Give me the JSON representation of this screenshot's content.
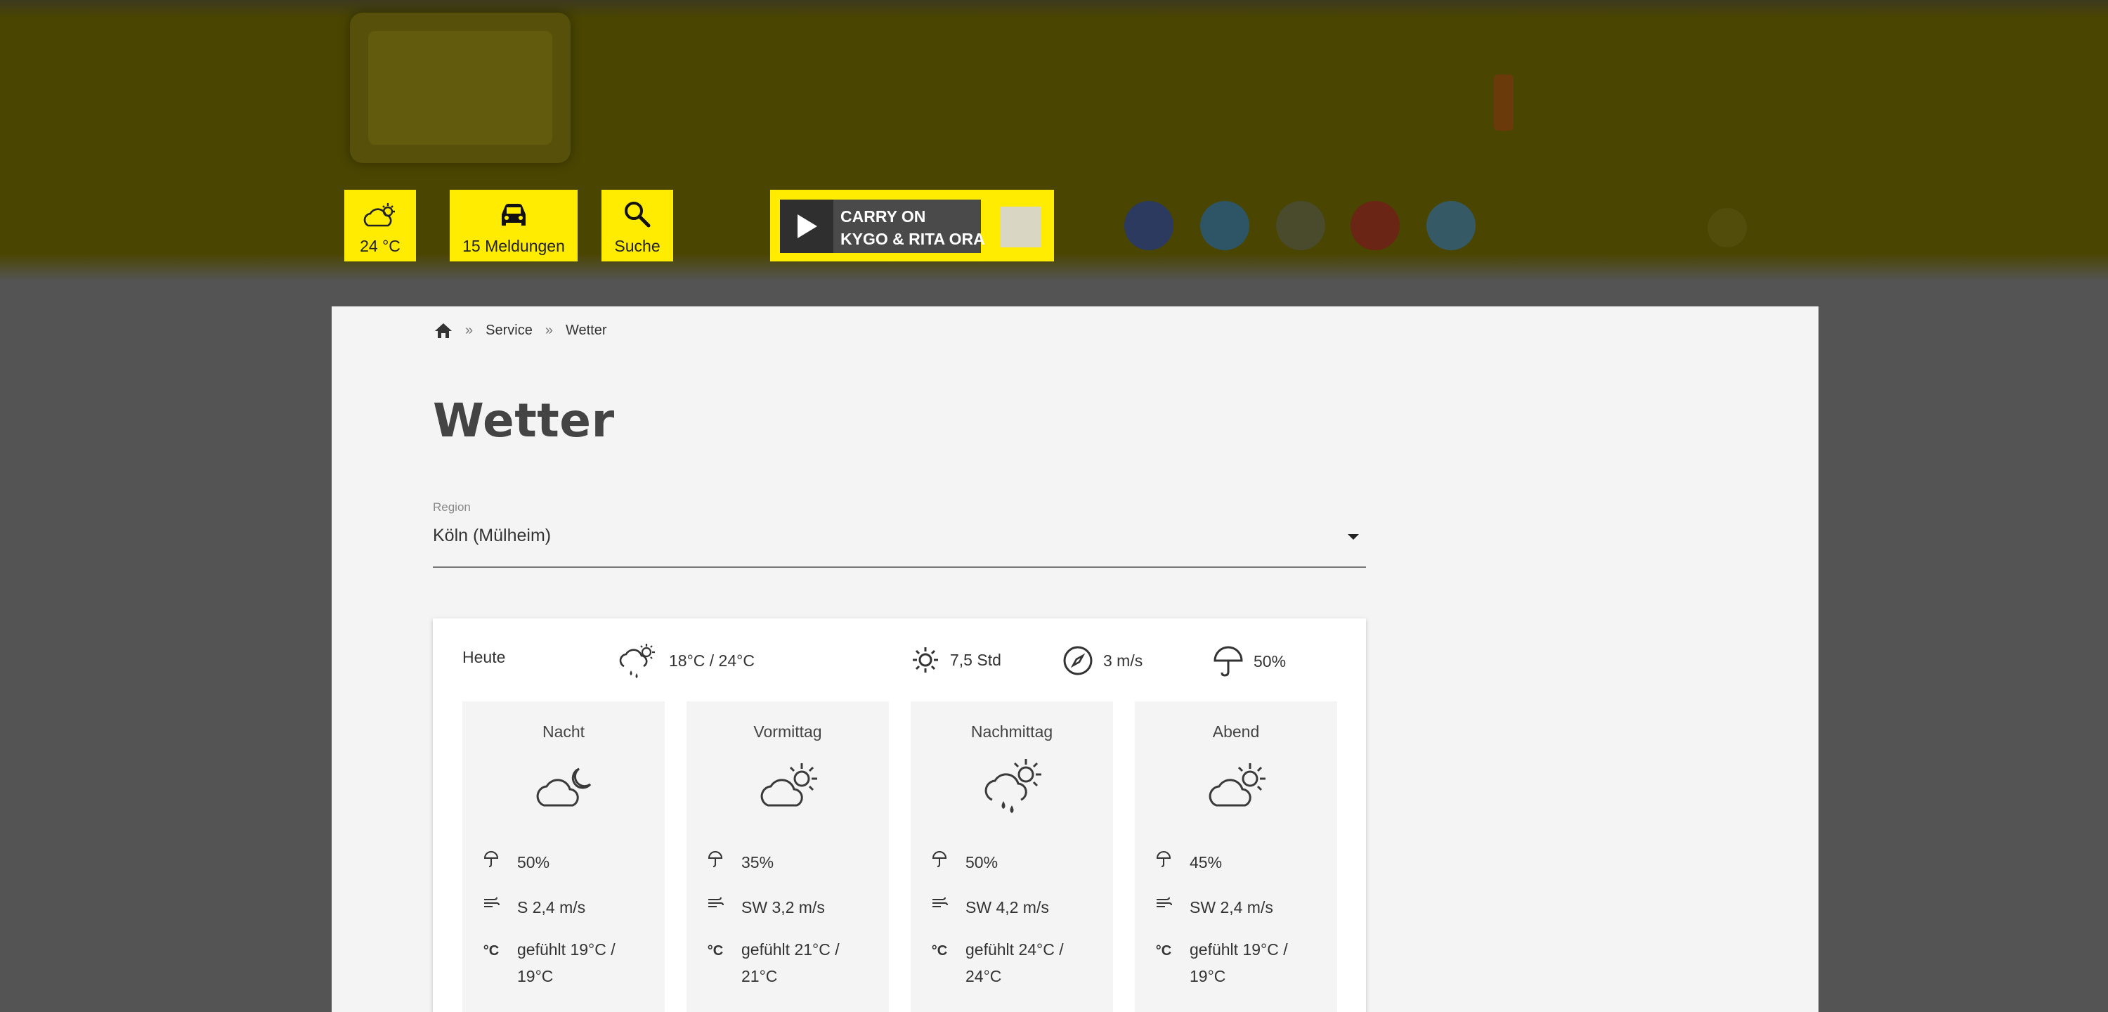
{
  "header": {
    "weather_label": "24 °C",
    "traffic_label": "15 Meldungen",
    "search_label": "Suche",
    "player": {
      "line1": "CARRY ON",
      "line2": "KYGO & RITA ORA"
    },
    "colors": {
      "accent": "#ffec00",
      "overlay": "#4a4500"
    },
    "social_icons": [
      "facebook-icon",
      "twitter-icon",
      "instagram-icon",
      "youtube-icon",
      "telegram-icon"
    ]
  },
  "breadcrumb": {
    "home_icon": "home-icon",
    "items": [
      "Service",
      "Wetter"
    ],
    "separator": "»"
  },
  "page": {
    "title": "Wetter"
  },
  "region": {
    "label": "Region",
    "value": "Köln (Mülheim)"
  },
  "today": {
    "label": "Heute",
    "temp": "18°C / 24°C",
    "sun": "7,5 Std",
    "wind": "3 m/s",
    "rain": "50%"
  },
  "slots": [
    {
      "name": "Nacht",
      "icon": "cloud-moon-icon",
      "rain": "50%",
      "wind": "S 2,4 m/s",
      "felt": "gefühlt 19°C / 19°C"
    },
    {
      "name": "Vormittag",
      "icon": "cloud-sun-icon",
      "rain": "35%",
      "wind": "SW 3,2 m/s",
      "felt": "gefühlt 21°C / 21°C"
    },
    {
      "name": "Nachmittag",
      "icon": "cloud-sun-rain-icon",
      "rain": "50%",
      "wind": "SW 4,2 m/s",
      "felt": "gefühlt 24°C / 24°C"
    },
    {
      "name": "Abend",
      "icon": "cloud-sun-icon",
      "rain": "45%",
      "wind": "SW 2,4 m/s",
      "felt": "gefühlt 19°C / 19°C"
    }
  ],
  "celsius_symbol": "°C"
}
